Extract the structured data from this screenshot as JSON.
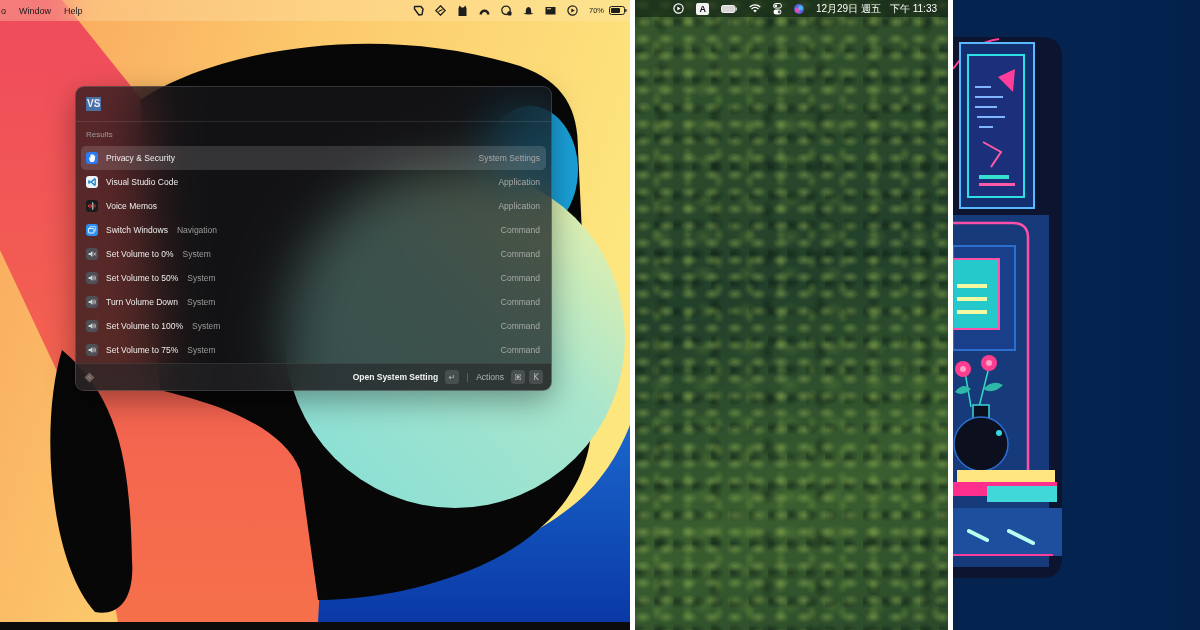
{
  "left_screen": {
    "menu_bar": {
      "menus": [
        {
          "label": "o"
        },
        {
          "label": "Window"
        },
        {
          "label": "Help"
        }
      ],
      "battery_percent": "70%"
    },
    "launcher": {
      "search": {
        "value": "VS",
        "text_selected": true
      },
      "section_title": "Results",
      "results": [
        {
          "kind": "privacy",
          "title": "Privacy & Security",
          "accessory": "System Settings",
          "selected": true
        },
        {
          "kind": "code_editor",
          "title": "Visual Studio Code",
          "accessory": "Application",
          "selected": false
        },
        {
          "kind": "voice_memos",
          "title": "Voice Memos",
          "accessory": "Application",
          "selected": false
        },
        {
          "kind": "windows",
          "title": "Switch Windows",
          "subtitle": "Navigation",
          "accessory": "Command",
          "selected": false
        },
        {
          "kind": "mute",
          "title": "Set Volume to 0%",
          "subtitle": "System",
          "accessory": "Command",
          "selected": false
        },
        {
          "kind": "volume",
          "title": "Set Volume to 50%",
          "subtitle": "System",
          "accessory": "Command",
          "selected": false
        },
        {
          "kind": "volume",
          "title": "Turn Volume Down",
          "subtitle": "System",
          "accessory": "Command",
          "selected": false
        },
        {
          "kind": "volume",
          "title": "Set Volume to 100%",
          "subtitle": "System",
          "accessory": "Command",
          "selected": false
        },
        {
          "kind": "volume",
          "title": "Set Volume to 75%",
          "subtitle": "System",
          "accessory": "Command",
          "selected": false
        }
      ],
      "footer": {
        "primary_action": "Open System Setting",
        "primary_key": "↵",
        "actions_label": "Actions",
        "actions_keys": [
          "⌘",
          "K"
        ]
      }
    }
  },
  "middle_screen": {
    "menu_bar": {
      "input_source": "A",
      "date": "12月29日 週五",
      "time": "下午 11:33"
    }
  }
}
